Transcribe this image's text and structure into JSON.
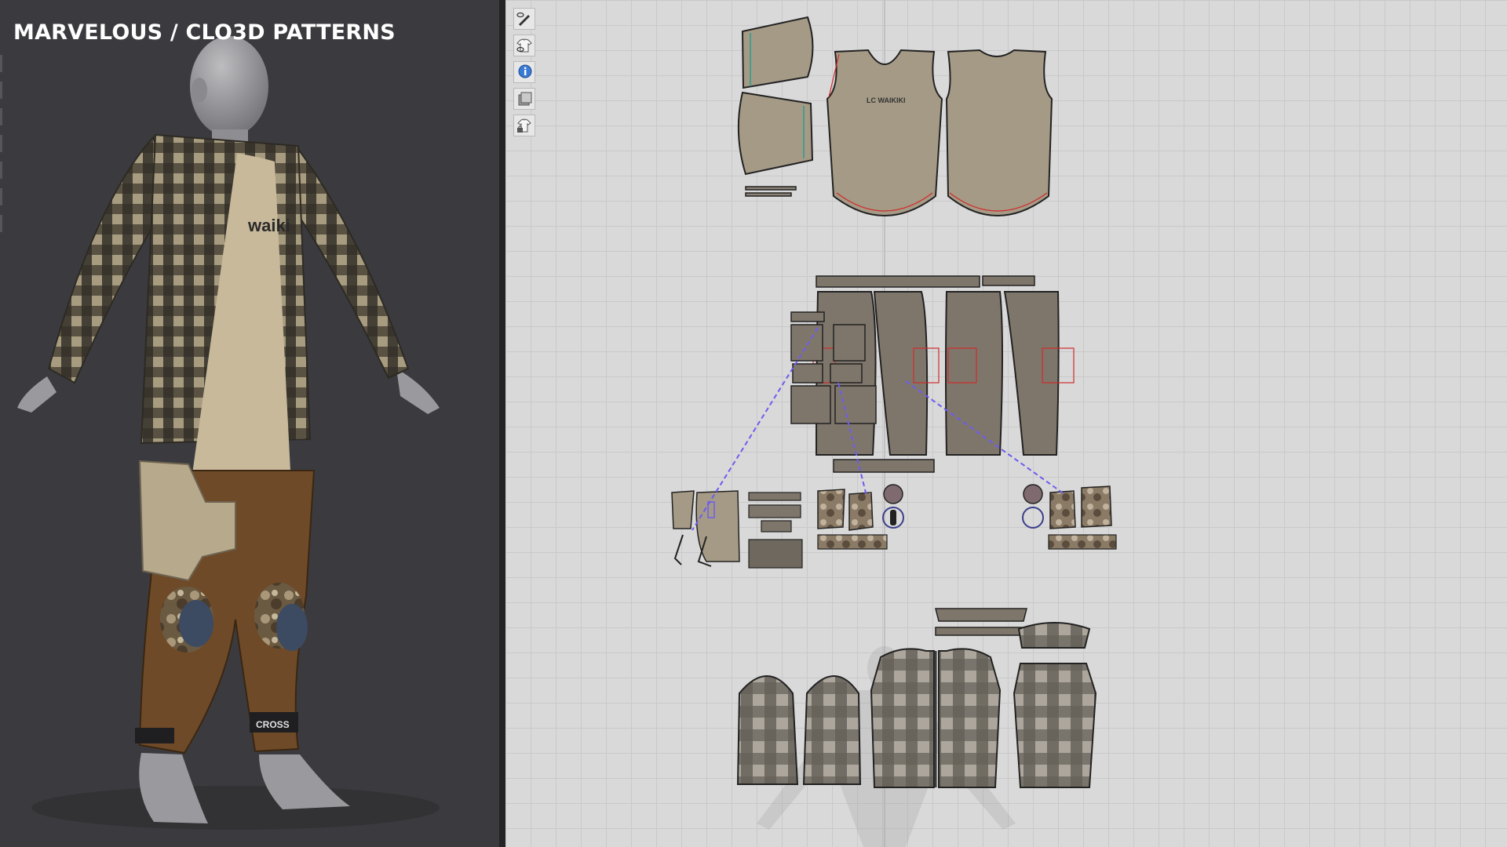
{
  "overlay": {
    "title": "MARVELOUS / CLO3D PATTERNS"
  },
  "avatar_garments": {
    "tshirt_print": "waiki",
    "cuff_label": "CROSS"
  },
  "pattern_window": {
    "tshirt_print": "LC WAIKIKI",
    "toolbar": [
      {
        "name": "edit-pattern-tool",
        "icon": "pen-eye-icon"
      },
      {
        "name": "show-garment-tool",
        "icon": "shirt-eye-icon"
      },
      {
        "name": "info-tool",
        "icon": "info-icon"
      },
      {
        "name": "texture-tool",
        "icon": "texture-icon"
      },
      {
        "name": "lock-garment-tool",
        "icon": "shirt-lock-icon"
      }
    ]
  },
  "colors": {
    "viewport_bg": "#3b3b3f",
    "pattern_bg": "#d9d9d9",
    "khaki_piece": "#a59a86",
    "pants_piece": "#7f766b",
    "plaid_piece": "#8b857b",
    "seam_red": "#d02a2a",
    "link_blue": "#6d5cf0"
  }
}
